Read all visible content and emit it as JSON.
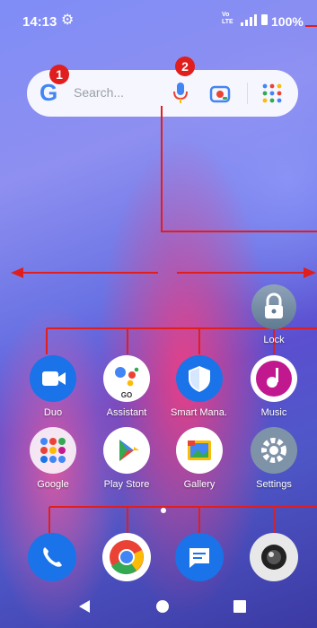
{
  "status_bar": {
    "time": "14:13",
    "volte_top": "Vo",
    "volte_bottom": "LTE",
    "battery": "100%"
  },
  "search_bar": {
    "google_glyph": "G",
    "placeholder": "Search...",
    "icons": [
      "google-logo",
      "microphone-icon",
      "lens-icon",
      "apps-grid-icon"
    ]
  },
  "callouts": {
    "one": "1",
    "two": "2"
  },
  "lock": {
    "label": "Lock"
  },
  "apps_row1": [
    {
      "label": "Duo",
      "icon": "duo-icon"
    },
    {
      "label": "Assistant",
      "icon": "assistant-icon",
      "sub": "GO"
    },
    {
      "label": "Smart Mana...",
      "icon": "shield-icon"
    },
    {
      "label": "Music",
      "icon": "music-icon"
    }
  ],
  "apps_row2": [
    {
      "label": "Google",
      "icon": "google-folder-icon"
    },
    {
      "label": "Play Store",
      "icon": "play-store-icon"
    },
    {
      "label": "Gallery",
      "icon": "gallery-icon"
    },
    {
      "label": "Settings",
      "icon": "settings-icon"
    }
  ],
  "dock": [
    {
      "icon": "phone-icon"
    },
    {
      "icon": "chrome-icon"
    },
    {
      "icon": "messages-icon"
    },
    {
      "icon": "camera-icon"
    }
  ],
  "nav": {
    "back": "back-icon",
    "home": "home-icon",
    "recents": "recents-icon"
  },
  "colors": {
    "annotation": "#e01e1e",
    "accent_blue": "#1a73e8"
  }
}
